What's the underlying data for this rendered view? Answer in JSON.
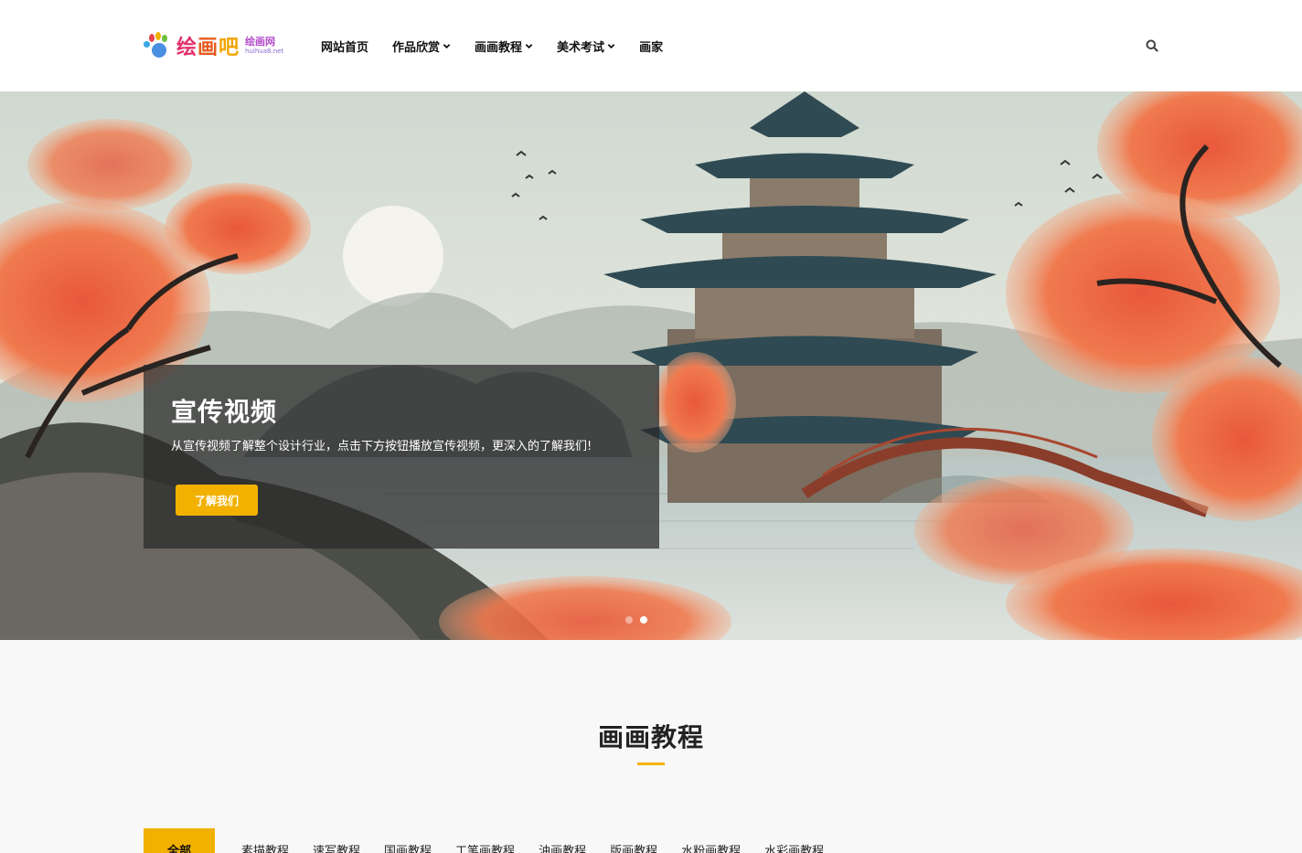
{
  "header": {
    "logo": {
      "main": [
        "绘",
        "画",
        "吧"
      ],
      "sub_cn": "绘画网",
      "sub_en": "huihua8.net"
    },
    "nav": [
      {
        "label": "网站首页",
        "dropdown": false
      },
      {
        "label": "作品欣赏",
        "dropdown": true
      },
      {
        "label": "画画教程",
        "dropdown": true
      },
      {
        "label": "美术考试",
        "dropdown": true
      },
      {
        "label": "画家",
        "dropdown": false
      }
    ],
    "search_icon": "search-icon"
  },
  "hero": {
    "title": "宣传视频",
    "description": "从宣传视频了解整个设计行业，点击下方按钮播放宣传视频，更深入的了解我们!",
    "button_label": "了解我们",
    "slides_total": 2,
    "active_slide": 1
  },
  "section": {
    "title": "画画教程",
    "tabs": [
      "全部",
      "素描教程",
      "速写教程",
      "国画教程",
      "工笔画教程",
      "油画教程",
      "版画教程",
      "水粉画教程",
      "水彩画教程"
    ],
    "active_tab": 0
  },
  "colors": {
    "accent": "#f2b100",
    "header_bg": "#ffffff",
    "page_bg": "#f8f8f8",
    "caption_bg": "rgba(40,40,40,0.72)"
  }
}
